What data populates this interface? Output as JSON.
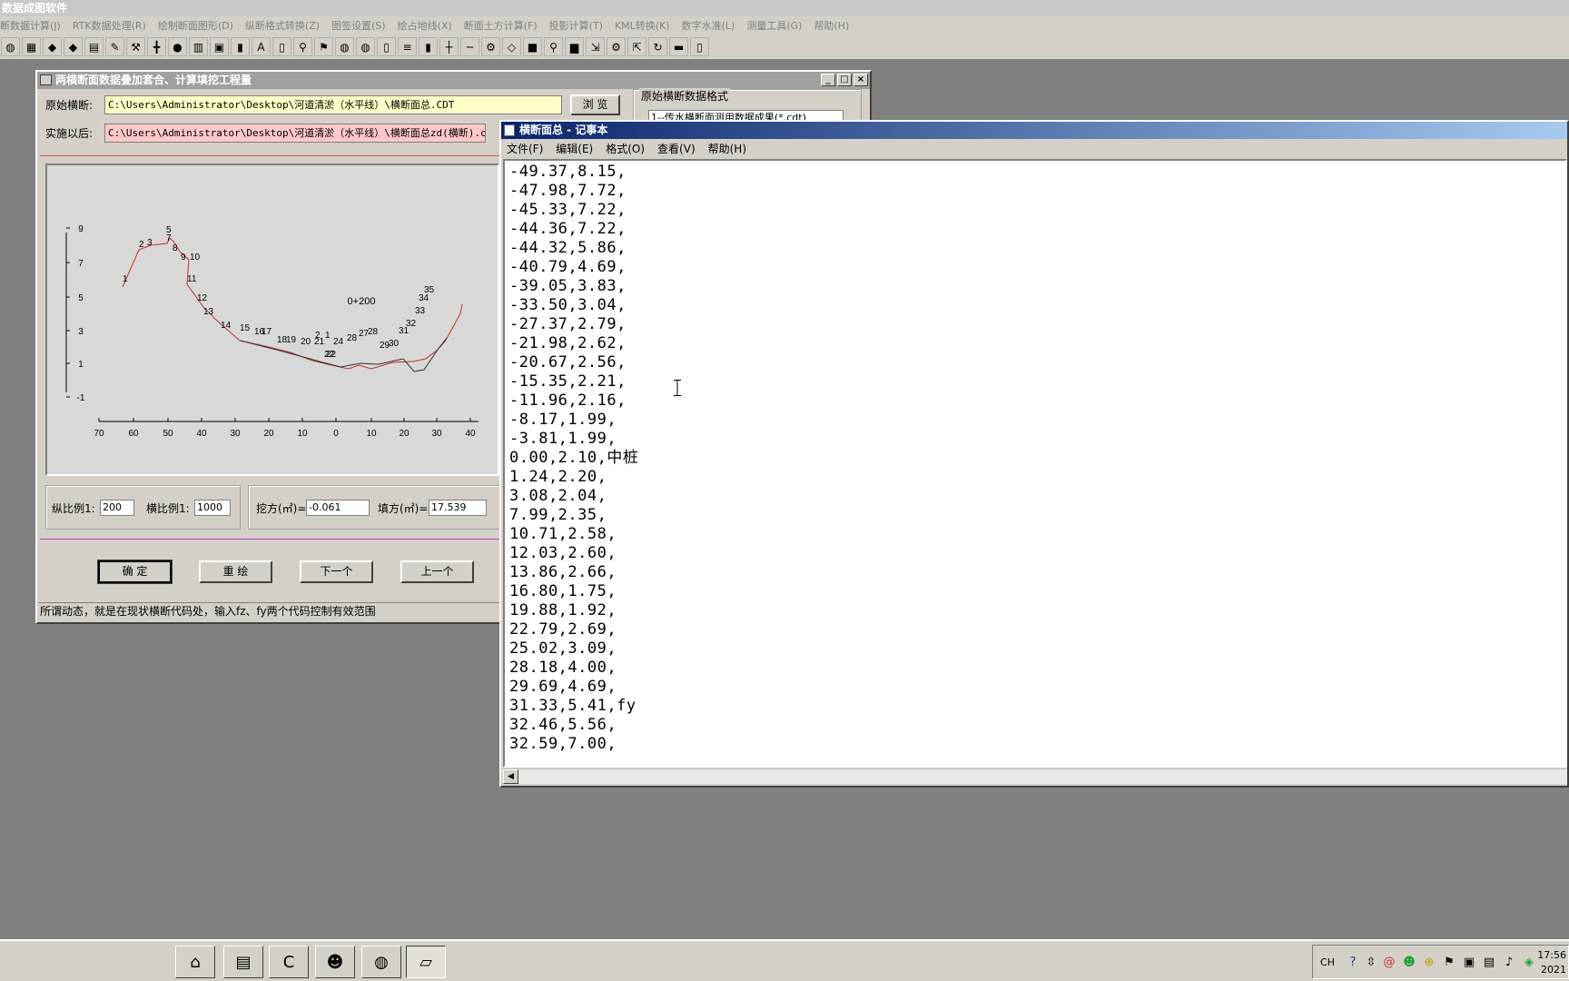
{
  "app": {
    "title": "数据成图软件"
  },
  "menu": [
    "断数据计算(J)",
    "RTK数据处理(R)",
    "绘制断面图形(D)",
    "纵断格式转换(Z)",
    "图签设置(S)",
    "绘占地线(X)",
    "断面土方计算(F)",
    "投影计算(T)",
    "KML转换(K)",
    "数字水准(L)",
    "测量工具(G)",
    "帮助(H)"
  ],
  "toolbar_icons": [
    "globe-icon",
    "grid-icon",
    "diamond-icon",
    "diamond-icon",
    "chart-icon",
    "pencil-icon",
    "wrench-icon",
    "plus-icon",
    "dot-icon",
    "table-icon",
    "image-icon",
    "bar-chart-icon",
    "text-icon",
    "document-icon",
    "magnify-icon",
    "flag-icon",
    "globe-icon",
    "globe-icon",
    "page-icon",
    "list-icon",
    "bars-icon",
    "cross-icon",
    "minus-icon",
    "tool-icon",
    "diamond-icon",
    "cube-icon",
    "magnify-icon",
    "book-icon",
    "export-icon",
    "gear-icon",
    "import-icon",
    "rotate-icon",
    "stamp-icon",
    "page-icon"
  ],
  "toolbar_glyphs": [
    "◍",
    "▦",
    "◆",
    "◆",
    "▤",
    "✎",
    "⚒",
    "╋",
    "●",
    "▥",
    "▣",
    "▮",
    "A",
    "▯",
    "⚲",
    "⚑",
    "◍",
    "◍",
    "▯",
    "≡",
    "▮",
    "┼",
    "─",
    "⚙",
    "◇",
    "■",
    "⚲",
    "▆",
    "⇲",
    "⚙",
    "⇱",
    "↻",
    "▬",
    "▯"
  ],
  "dialog": {
    "title": "两横断面数据叠加套合、计算填挖工程量",
    "original_label": "原始横断:",
    "original_path": "C:\\Users\\Administrator\\Desktop\\河道清淤（水平线）\\横断面总.CDT",
    "after_label": "实施以后:",
    "after_path": "C:\\Users\\Administrator\\Desktop\\河道清淤（水平线）\\横断面总zd(横断).ccs",
    "browse_label": "浏 览",
    "format_group_label": "原始横断数据格式",
    "format_select_value": "1--传水横断面测用数据成果(*.cdt)",
    "plot": {
      "station_label": "0+200",
      "y_ticks": [
        "9",
        "7",
        "5",
        "3",
        "1",
        "-1"
      ],
      "x_ticks": [
        "70",
        "60",
        "50",
        "40",
        "30",
        "20",
        "10",
        "0",
        "10",
        "20",
        "30",
        "40"
      ],
      "point_labels": [
        "1",
        "2",
        "3",
        "5",
        "7",
        "8",
        "9",
        "10",
        "11",
        "12",
        "13",
        "14",
        "15",
        "16",
        "17",
        "18",
        "19",
        "20",
        "21",
        "2",
        "1",
        "22",
        "24",
        "28",
        "27",
        "28",
        "29",
        "30",
        "31",
        "32",
        "33",
        "34",
        "35",
        "22"
      ]
    },
    "vscale_label": "纵比例1:",
    "vscale_value": "200",
    "hscale_label": "横比例1:",
    "hscale_value": "1000",
    "cut_label": "挖方(㎡)=",
    "cut_value": "-0.061",
    "fill_label": "填方(㎡)=",
    "fill_value": "17.539",
    "buttons": {
      "ok": "确 定",
      "redraw": "重 绘",
      "next": "下一个",
      "prev": "上一个"
    },
    "status": "所谓动态，就是在现状横断代码处，输入fz、fy两个代码控制有效范围"
  },
  "notepad": {
    "title": "横断面总 - 记事本",
    "menu": [
      "文件(F)",
      "编辑(E)",
      "格式(O)",
      "查看(V)",
      "帮助(H)"
    ],
    "lines": [
      "-49.37,8.15,",
      "-47.98,7.72,",
      "-45.33,7.22,",
      "-44.36,7.22,",
      "-44.32,5.86,",
      "-40.79,4.69,",
      "-39.05,3.83,",
      "-33.50,3.04,",
      "-27.37,2.79,",
      "-21.98,2.62,",
      "-20.67,2.56,",
      "-15.35,2.21,",
      "-11.96,2.16,",
      "-8.17,1.99,",
      "-3.81,1.99,",
      "0.00,2.10,中桩",
      "1.24,2.20,",
      "3.08,2.04,",
      "7.99,2.35,",
      "10.71,2.58,",
      "12.03,2.60,",
      "13.86,2.66,",
      "16.80,1.75,",
      "19.88,1.92,",
      "22.79,2.69,",
      "25.02,3.09,",
      "28.18,4.00,",
      "29.69,4.69,",
      "31.33,5.41,fy",
      "32.46,5.56,",
      "32.59,7.00,"
    ]
  },
  "taskbar": {
    "tasks": [
      {
        "name": "task-app-icon",
        "glyph": "⌂"
      },
      {
        "name": "task-folder-icon",
        "glyph": "▤"
      },
      {
        "name": "task-c9-icon",
        "glyph": "C"
      },
      {
        "name": "task-wechat-icon",
        "glyph": "☻"
      },
      {
        "name": "task-globe-icon",
        "glyph": "◍"
      },
      {
        "name": "task-notepad-icon",
        "glyph": "▱"
      }
    ],
    "lang": "CH",
    "time": "17:56",
    "date": "2021"
  }
}
